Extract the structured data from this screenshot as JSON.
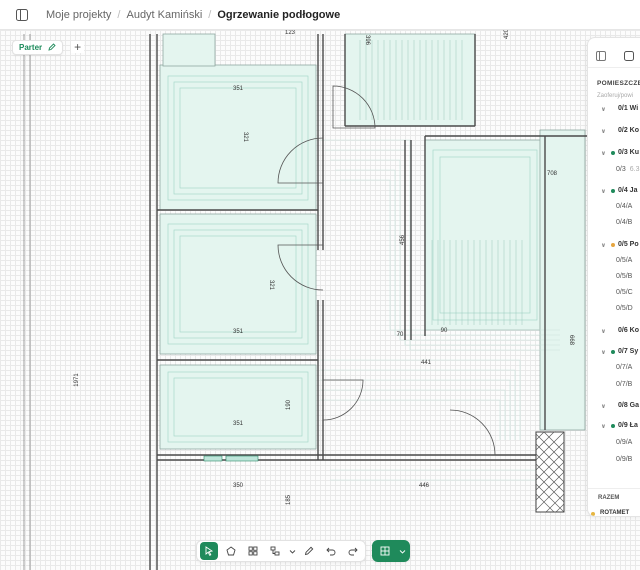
{
  "breadcrumb": {
    "items": [
      "Moje projekty",
      "Audyt Kamiński",
      "Ogrzewanie podłogowe"
    ]
  },
  "floor": {
    "label": "Parter",
    "add": "+"
  },
  "plan": {
    "dims": [
      "123",
      "396",
      "420",
      "351",
      "321",
      "456",
      "351",
      "321",
      "351",
      "70",
      "90",
      "441",
      "708",
      "668",
      "1971",
      "351",
      "190",
      "350",
      "446",
      "185"
    ]
  },
  "panel": {
    "heading": "POMIESZCZE",
    "hint": "Zaoferuj/powi",
    "rooms": [
      {
        "label": "0/1 Wi",
        "level": "room",
        "dot": "",
        "chevron": "∨"
      },
      {
        "label": "0/2 Ko",
        "level": "room",
        "dot": "",
        "chevron": "∨"
      },
      {
        "label": "0/3 Ku",
        "level": "room",
        "dot": "#1f8a5b",
        "chevron": "∨"
      },
      {
        "label": "0/3",
        "level": "sub",
        "extra": "6.3"
      },
      {
        "label": "0/4 Ja",
        "level": "room",
        "dot": "#1f8a5b",
        "chevron": "∨"
      },
      {
        "label": "0/4/A",
        "level": "sub"
      },
      {
        "label": "0/4/B",
        "level": "sub"
      },
      {
        "label": "0/5 Po",
        "level": "room",
        "dot": "#e6a640",
        "chevron": "∨"
      },
      {
        "label": "0/5/A",
        "level": "sub"
      },
      {
        "label": "0/5/B",
        "level": "sub"
      },
      {
        "label": "0/5/C",
        "level": "sub"
      },
      {
        "label": "0/5/D",
        "level": "sub"
      },
      {
        "label": "0/6 Ko",
        "level": "room",
        "dot": "",
        "chevron": "∨"
      },
      {
        "label": "0/7 Sy",
        "level": "room",
        "dot": "#1f8a5b",
        "chevron": "∨"
      },
      {
        "label": "0/7/A",
        "level": "sub"
      },
      {
        "label": "0/7/B",
        "level": "sub"
      },
      {
        "label": "0/8 Ga",
        "level": "room",
        "dot": "",
        "chevron": "∨"
      },
      {
        "label": "0/9 Ła",
        "level": "room",
        "dot": "#1f8a5b",
        "chevron": "∨"
      },
      {
        "label": "0/9/A",
        "level": "sub"
      },
      {
        "label": "0/9/B",
        "level": "sub"
      }
    ],
    "summary_label": "RAZEM",
    "rotameter": "ROTAMET"
  },
  "toolbar": {
    "tools": [
      "select-icon",
      "polygon-icon",
      "grid-icon",
      "layers-icon",
      "chevron-down-icon",
      "pencil-icon",
      "undo-icon",
      "redo-icon"
    ],
    "view": [
      "grid-view-icon",
      "chevron-down-icon"
    ]
  },
  "colors": {
    "accent": "#1f8a5b",
    "room_fill": "#e4f5ef",
    "pipe": "#a8d9cc",
    "warning": "#e6a640"
  }
}
